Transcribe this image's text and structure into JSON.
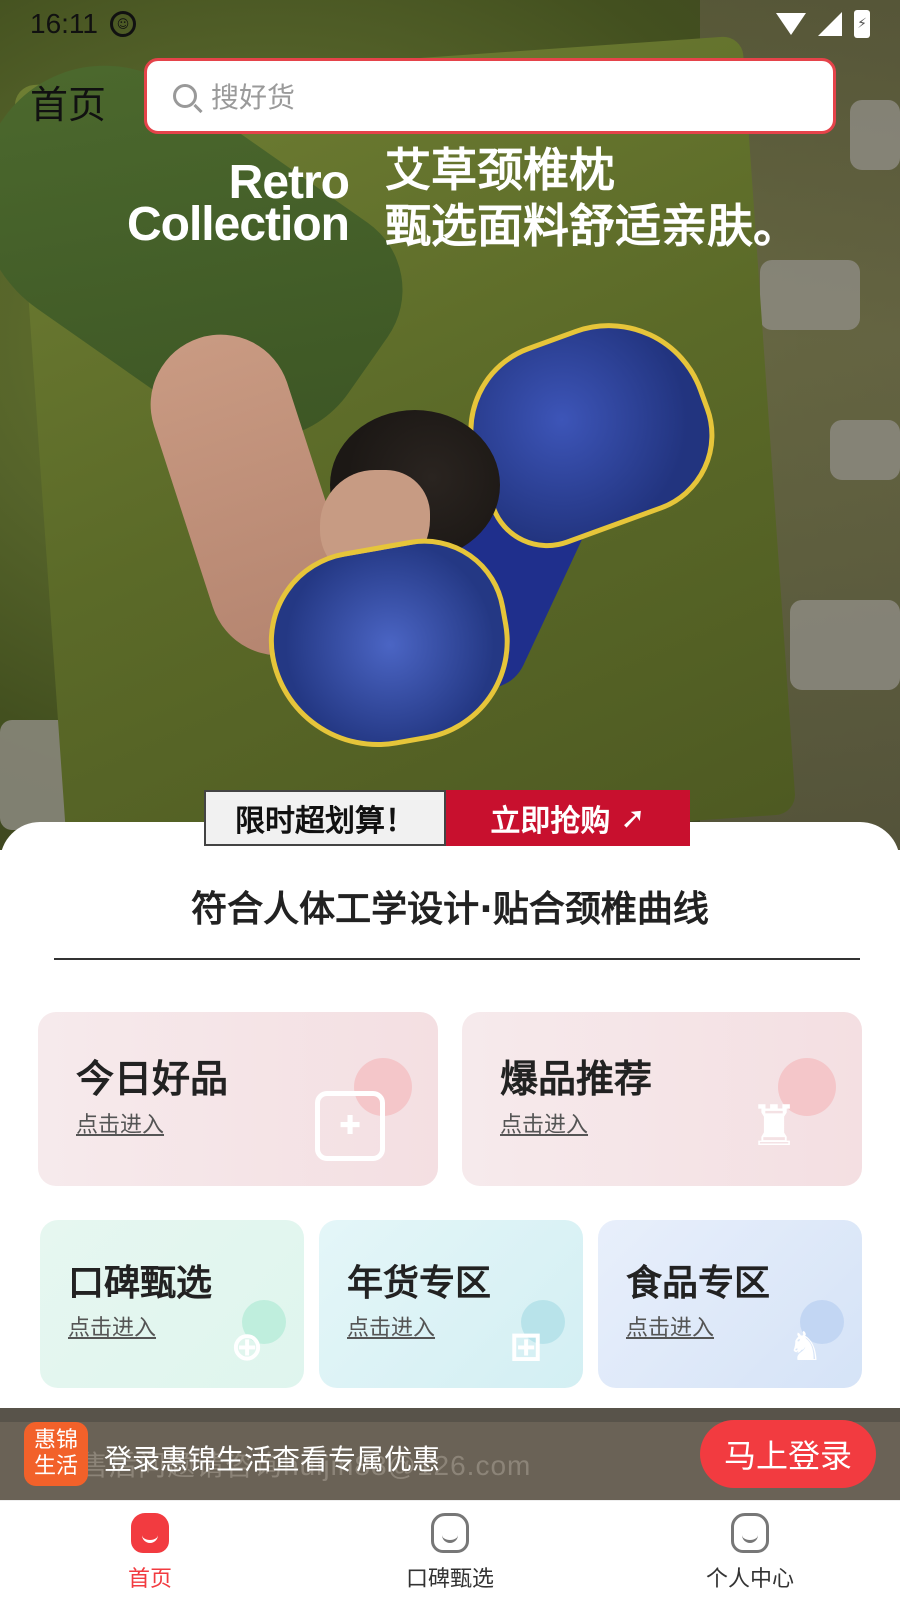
{
  "status_bar": {
    "time": "16:11"
  },
  "header": {
    "home_label": "首页",
    "search_placeholder": "搜好货"
  },
  "banner": {
    "retro_line1": "Retro",
    "retro_line2": "Collection",
    "promo_line1": "艾草颈椎枕",
    "promo_line2": "甄选面料舒适亲肤。",
    "deal_left": "限时超划算！",
    "deal_right": "立即抢购"
  },
  "content": {
    "ergonomic_text": "符合人体工学设计·贴合颈椎曲线"
  },
  "tiles": [
    {
      "title": "今日好品",
      "sub": "点击进入",
      "icon": "food-box-icon"
    },
    {
      "title": "爆品推荐",
      "sub": "点击进入",
      "icon": "bottle-icon"
    },
    {
      "title": "口碑甄选",
      "sub": "点击进入",
      "icon": "medical-kit-icon"
    },
    {
      "title": "年货专区",
      "sub": "点击进入",
      "icon": "brush-icon"
    },
    {
      "title": "食品专区",
      "sub": "点击进入",
      "icon": "dog-icon"
    }
  ],
  "login_banner": {
    "brand": "惠锦生活",
    "text": "登录惠锦生活查看专属优惠",
    "background_text": "售后问题请咨询huijin88@126.com",
    "button": "马上登录"
  },
  "bottom_nav": [
    {
      "label": "首页",
      "active": true
    },
    {
      "label": "口碑甄选",
      "active": false
    },
    {
      "label": "个人中心",
      "active": false
    }
  ],
  "colors": {
    "accent": "#f23b40",
    "deal_red": "#c8102e",
    "brand_orange": "#f2612a"
  }
}
